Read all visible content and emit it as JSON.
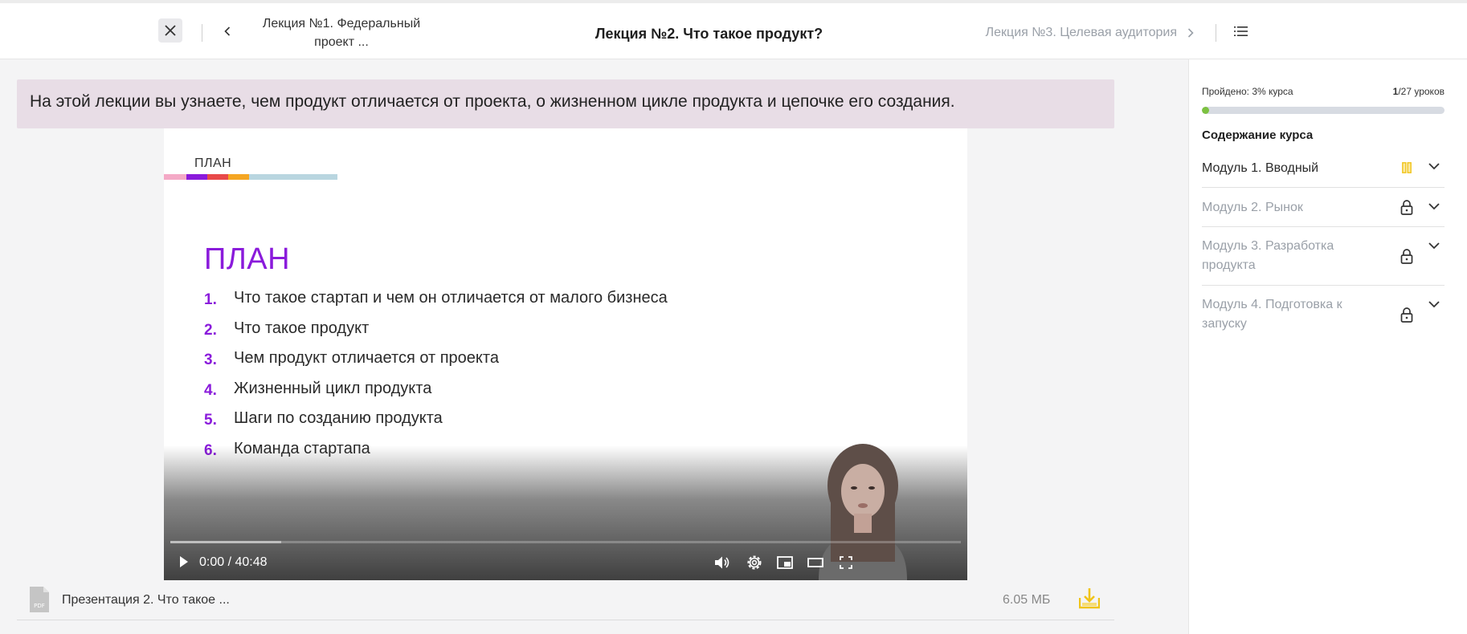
{
  "header": {
    "prev_lecture": "Лекция №1. Федеральный проект ...",
    "current_lecture": "Лекция №2. Что такое продукт?",
    "next_lecture": "Лекция №3. Целевая аудитория"
  },
  "banner": {
    "text": "На этой лекции вы узнаете, чем продукт отличается от проекта, о жизненном цикле продукта и цепочке его создания."
  },
  "slide": {
    "tag": "ПЛАН",
    "heading": "ПЛАН",
    "items": [
      {
        "num": "1.",
        "text": "Что такое стартап и чем он отличается от малого бизнеса"
      },
      {
        "num": "2.",
        "text": "Что такое продукт"
      },
      {
        "num": "3.",
        "text": "Чем продукт отличается от проекта"
      },
      {
        "num": "4.",
        "text": "Жизненный цикл продукта"
      },
      {
        "num": "5.",
        "text": "Шаги по созданию продукта"
      },
      {
        "num": "6.",
        "text": "Команда стартапа"
      }
    ],
    "stripe_colors": [
      "#f4a9c6",
      "#8a1bdb",
      "#e84a4a",
      "#f5a623",
      "#b9d6e0"
    ]
  },
  "video": {
    "time": "0:00 / 40:48",
    "played_fraction": 0,
    "buffered_fraction": 0.14
  },
  "attachment": {
    "name": "Презентация 2. Что такое ...",
    "size": "6.05 МБ",
    "type_label": "PDF"
  },
  "sidebar": {
    "passed_label": "Пройдено: 3% курса",
    "passed_fraction": 0.03,
    "lessons_done": "1",
    "lessons_total": "/27 уроков",
    "content_title": "Содержание курса",
    "modules": [
      {
        "label": "Модуль 1. Вводный",
        "status": "in-progress",
        "locked": false
      },
      {
        "label": "Модуль 2. Рынок",
        "status": "locked",
        "locked": true
      },
      {
        "label": "Модуль 3. Разработка продукта",
        "status": "locked",
        "locked": true
      },
      {
        "label": "Модуль 4. Подготовка к запуску",
        "status": "locked",
        "locked": true
      }
    ]
  },
  "colors": {
    "accent_purple": "#8a1bdb",
    "banner_bg": "#e8dde6",
    "progress_green": "#7cc140",
    "download_yellow": "#f0c419"
  }
}
